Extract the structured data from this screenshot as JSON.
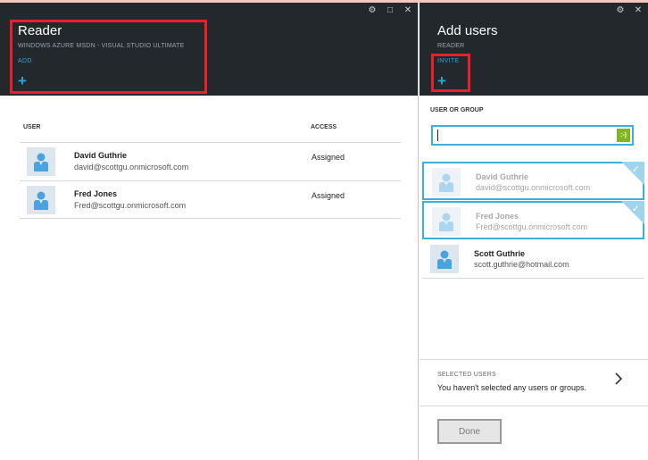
{
  "reader_blade": {
    "title": "Reader",
    "subtitle": "WINDOWS AZURE MSDN - VISUAL STUDIO ULTIMATE",
    "command_label": "ADD",
    "plus_glyph": "+",
    "columns": {
      "user": "USER",
      "access": "ACCESS"
    },
    "rows": [
      {
        "name": "David Guthrie",
        "email": "david@scottgu.onmicrosoft.com",
        "access": "Assigned"
      },
      {
        "name": "Fred Jones",
        "email": "Fred@scottgu.onmicrosoft.com",
        "access": "Assigned"
      }
    ]
  },
  "add_users_blade": {
    "title": "Add users",
    "subtitle": "READER",
    "command_label": "INVITE",
    "plus_glyph": "+",
    "search_label": "USER OR GROUP",
    "search_value": "",
    "search_badge": ":-)",
    "results": [
      {
        "name": "David Guthrie",
        "email": "david@scottgu.onmicrosoft.com",
        "state": "already-added"
      },
      {
        "name": "Fred Jones",
        "email": "Fred@scottgu.onmicrosoft.com",
        "state": "already-added"
      },
      {
        "name": "Scott Guthrie",
        "email": "scott.guthrie@hotmail.com",
        "state": "available"
      }
    ],
    "selected_users_label": "SELECTED USERS",
    "selected_users_message": "You haven't selected any users or groups.",
    "done_label": "Done"
  },
  "window_controls": {
    "settings_glyph": "⚙",
    "maximize_glyph": "□",
    "close_glyph": "✕"
  },
  "colors": {
    "header_bg": "#23282d",
    "accent": "#2aa7d6",
    "highlight_box": "#e8202a",
    "selection_border": "#3bb0df"
  }
}
